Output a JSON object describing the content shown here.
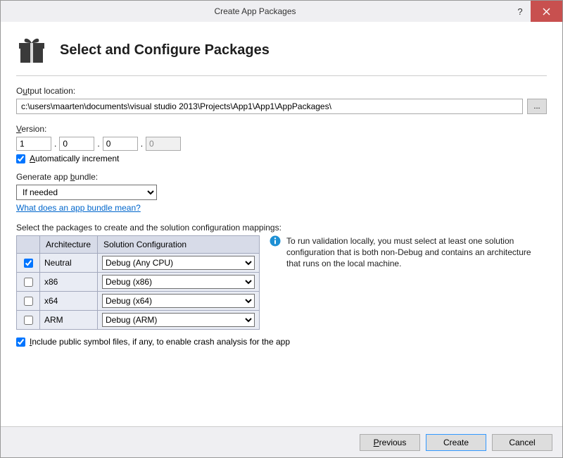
{
  "window": {
    "title": "Create App Packages"
  },
  "header": {
    "heading": "Select and Configure Packages"
  },
  "output": {
    "label_pre": "O",
    "label_u": "u",
    "label_post": "tput location:",
    "value": "c:\\users\\maarten\\documents\\visual studio 2013\\Projects\\App1\\App1\\AppPackages\\",
    "browse": "..."
  },
  "version": {
    "label_u": "V",
    "label_post": "ersion:",
    "major": "1",
    "minor": "0",
    "build": "0",
    "rev": "0",
    "auto_u": "A",
    "auto_post": "utomatically increment",
    "auto_checked": true
  },
  "bundle": {
    "label_pre": "Generate app ",
    "label_u": "b",
    "label_post": "undle:",
    "selected": "If needed",
    "link": "What does an app bundle mean?"
  },
  "mapping": {
    "intro": "Select the packages to create and the solution configuration mappings:",
    "col_arch": "Architecture",
    "col_conf": "Solution Configuration",
    "rows": [
      {
        "checked": true,
        "arch": "Neutral",
        "conf": "Debug (Any CPU)"
      },
      {
        "checked": false,
        "arch": "x86",
        "conf": "Debug (x86)"
      },
      {
        "checked": false,
        "arch": "x64",
        "conf": "Debug (x64)"
      },
      {
        "checked": false,
        "arch": "ARM",
        "conf": "Debug (ARM)"
      }
    ],
    "info": "To run validation locally, you must select at least one solution configuration that is both non-Debug and contains an architecture that runs on the local machine."
  },
  "symbols": {
    "u": "I",
    "post": "nclude public symbol files, if any, to enable crash analysis for the app",
    "checked": true
  },
  "footer": {
    "prev_u": "P",
    "prev_post": "revious",
    "create": "Create",
    "cancel": "Cancel"
  }
}
